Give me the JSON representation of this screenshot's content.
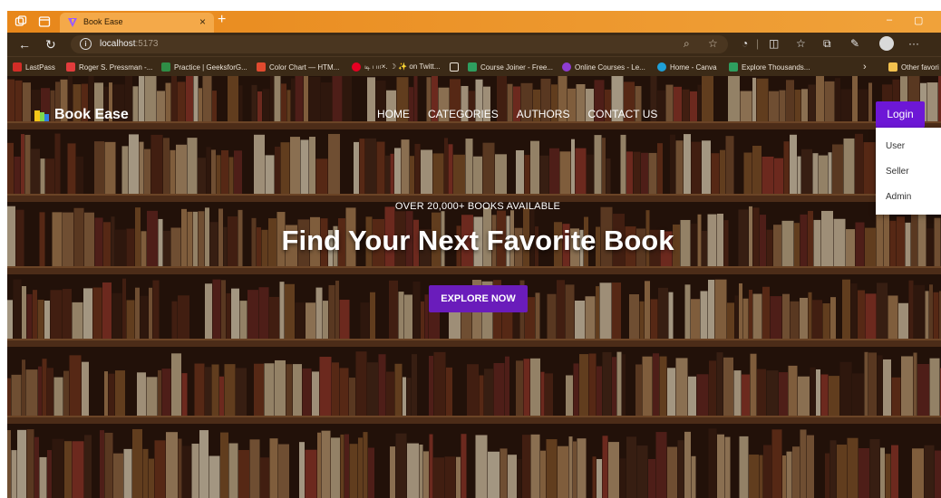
{
  "browser": {
    "tab_title": "Book Ease",
    "tab_close": "×",
    "new_tab": "+",
    "url_host": "localhost",
    "url_port": ":5173",
    "minimize": "–",
    "restore": "▢",
    "accent_color": "#e8871a"
  },
  "bookmarks": [
    {
      "label": "LastPass",
      "color": "#d32d27"
    },
    {
      "label": "Roger S. Pressman -...",
      "color": "#e23c3c"
    },
    {
      "label": "Practice | GeeksforG...",
      "color": "#2f8d46"
    },
    {
      "label": "Color Chart — HTM...",
      "color": "#e04a2f"
    },
    {
      "label": "டி பா×. ☽ ✨ on Twitt...",
      "color": "#e60023"
    },
    {
      "label": "",
      "color": "#ffffff"
    },
    {
      "label": "Course Joiner - Free...",
      "color": "#2e9e5f"
    },
    {
      "label": "Online Courses - Le...",
      "color": "#8e3dd1"
    },
    {
      "label": "Home - Canva",
      "color": "#1fa0d8"
    },
    {
      "label": "Explore Thousands...",
      "color": "#2e9e5f"
    }
  ],
  "bookmarks_more": "›",
  "bookmarks_other": "Other favori",
  "site": {
    "brand": "Book Ease",
    "nav": [
      "HOME",
      "CATEGORIES",
      "AUTHORS",
      "CONTACT US"
    ],
    "login_label": "Login",
    "login_menu": [
      "User",
      "Seller",
      "Admin"
    ],
    "tagline": "OVER 20,000+ BOOKS AVAILABLE",
    "headline": "Find Your Next Favorite Book",
    "cta_label": "EXPLORE NOW",
    "brand_color": "#6d17d6"
  }
}
